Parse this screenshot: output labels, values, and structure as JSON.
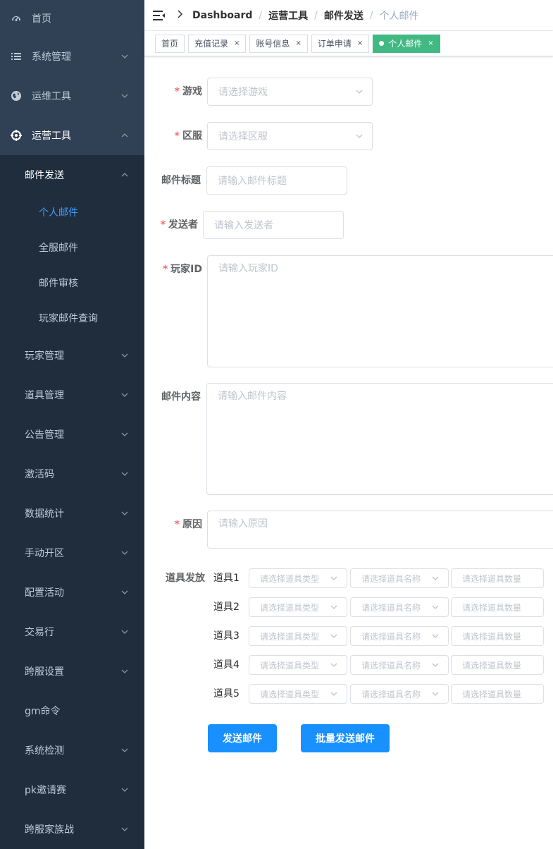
{
  "sidebar": {
    "items": [
      {
        "label": "首页",
        "icon": "dashboard-icon"
      },
      {
        "label": "系统管理",
        "icon": "list-icon"
      },
      {
        "label": "运维工具",
        "icon": "globe-icon"
      },
      {
        "label": "运营工具",
        "icon": "target-icon"
      }
    ],
    "submenu_title": "邮件发送",
    "leaves": [
      "个人邮件",
      "全服邮件",
      "邮件审核",
      "玩家邮件查询"
    ],
    "sub_items": [
      "玩家管理",
      "道具管理",
      "公告管理",
      "激活码",
      "数据统计",
      "手动开区",
      "配置活动",
      "交易行",
      "跨服设置",
      "gm命令",
      "系统检测",
      "pk邀请赛",
      "跨服家族战"
    ]
  },
  "breadcrumb": [
    "Dashboard",
    "运营工具",
    "邮件发送",
    "个人邮件"
  ],
  "tags": [
    {
      "label": "首页",
      "closable": false
    },
    {
      "label": "充值记录",
      "closable": true
    },
    {
      "label": "账号信息",
      "closable": true
    },
    {
      "label": "订单申请",
      "closable": true
    },
    {
      "label": "个人邮件",
      "closable": true,
      "active": true
    }
  ],
  "form": {
    "game": {
      "label": "游戏",
      "placeholder": "请选择游戏"
    },
    "server": {
      "label": "区服",
      "placeholder": "请选择区服"
    },
    "title": {
      "label": "邮件标题",
      "placeholder": "请输入邮件标题"
    },
    "sender": {
      "label": "发送者",
      "placeholder": "请输入发送者"
    },
    "player_id": {
      "label": "玩家ID",
      "placeholder": "请输入玩家ID"
    },
    "content": {
      "label": "邮件内容",
      "placeholder": "请输入邮件内容"
    },
    "reason": {
      "label": "原因",
      "placeholder": "请输入原因"
    },
    "items_label": "道具发放",
    "items": [
      {
        "label": "道具1",
        "type_ph": "请选择道具类型",
        "name_ph": "请选择道具名称",
        "qty_ph": "请选择道具数量"
      },
      {
        "label": "道具2",
        "type_ph": "请选择道具类型",
        "name_ph": "请选择道具名称",
        "qty_ph": "请选择道具数量"
      },
      {
        "label": "道具3",
        "type_ph": "请选择道具类型",
        "name_ph": "请选择道具名称",
        "qty_ph": "请选择道具数量"
      },
      {
        "label": "道具4",
        "type_ph": "请选择道具类型",
        "name_ph": "请选择道具名称",
        "qty_ph": "请选择道具数量"
      },
      {
        "label": "道具5",
        "type_ph": "请选择道具类型",
        "name_ph": "请选择道具名称",
        "qty_ph": "请选择道具数量"
      }
    ],
    "send_button": "发送邮件",
    "batch_button": "批量发送邮件"
  }
}
